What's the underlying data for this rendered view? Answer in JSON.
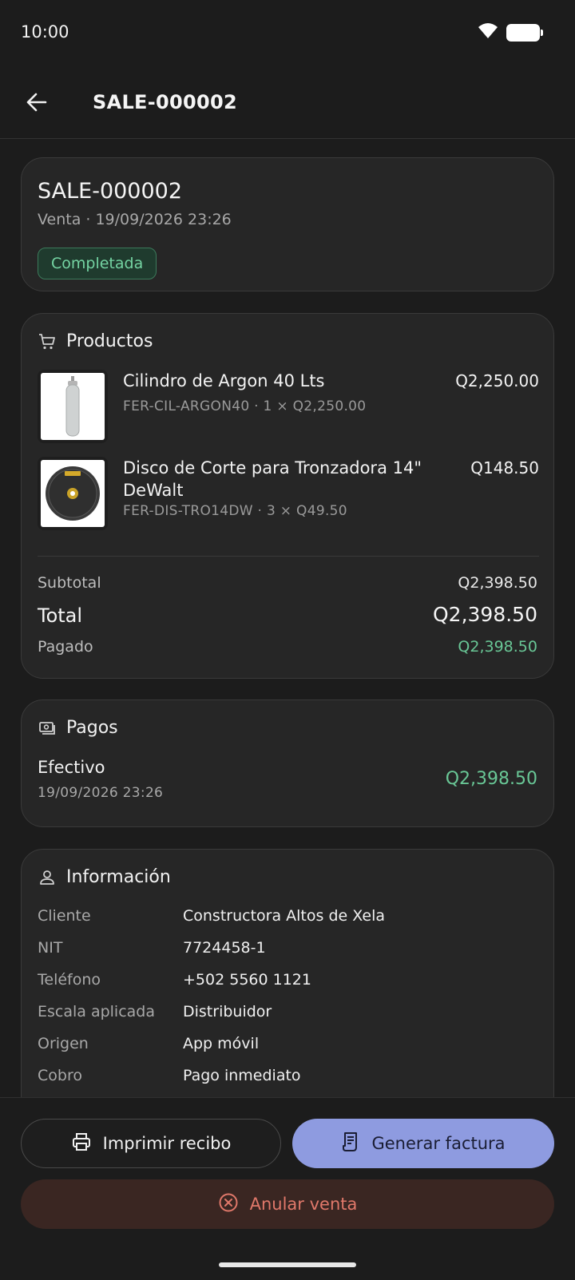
{
  "status": {
    "time": "10:00"
  },
  "header": {
    "title": "SALE-000002"
  },
  "summary": {
    "sale_id": "SALE-000002",
    "subtitle": "Venta · 19/09/2026 23:26",
    "status_badge": "Completada"
  },
  "products": {
    "heading": "Productos",
    "items": [
      {
        "name": "Cilindro de Argon 40 Lts",
        "meta": "FER-CIL-ARGON40 · 1 × Q2,250.00",
        "price": "Q2,250.00"
      },
      {
        "name": "Disco de Corte para Tronzadora 14\" DeWalt",
        "meta": "FER-DIS-TRO14DW · 3 × Q49.50",
        "price": "Q148.50"
      }
    ],
    "subtotal_label": "Subtotal",
    "subtotal_value": "Q2,398.50",
    "total_label": "Total",
    "total_value": "Q2,398.50",
    "paid_label": "Pagado",
    "paid_value": "Q2,398.50"
  },
  "payments": {
    "heading": "Pagos",
    "items": [
      {
        "method": "Efectivo",
        "date": "19/09/2026 23:26",
        "amount": "Q2,398.50"
      }
    ]
  },
  "info": {
    "heading": "Información",
    "rows": [
      {
        "label": "Cliente",
        "value": "Constructora Altos de Xela"
      },
      {
        "label": "NIT",
        "value": "7724458-1"
      },
      {
        "label": "Teléfono",
        "value": "+502 5560 1121"
      },
      {
        "label": "Escala aplicada",
        "value": "Distribuidor"
      },
      {
        "label": "Origen",
        "value": "App móvil"
      },
      {
        "label": "Cobro",
        "value": "Pago inmediato"
      }
    ]
  },
  "actions": {
    "print_label": "Imprimir recibo",
    "invoice_label": "Generar factura",
    "cancel_label": "Anular venta"
  },
  "colors": {
    "accent": "#8e9be0",
    "success": "#69c796",
    "danger": "#e0786a"
  }
}
